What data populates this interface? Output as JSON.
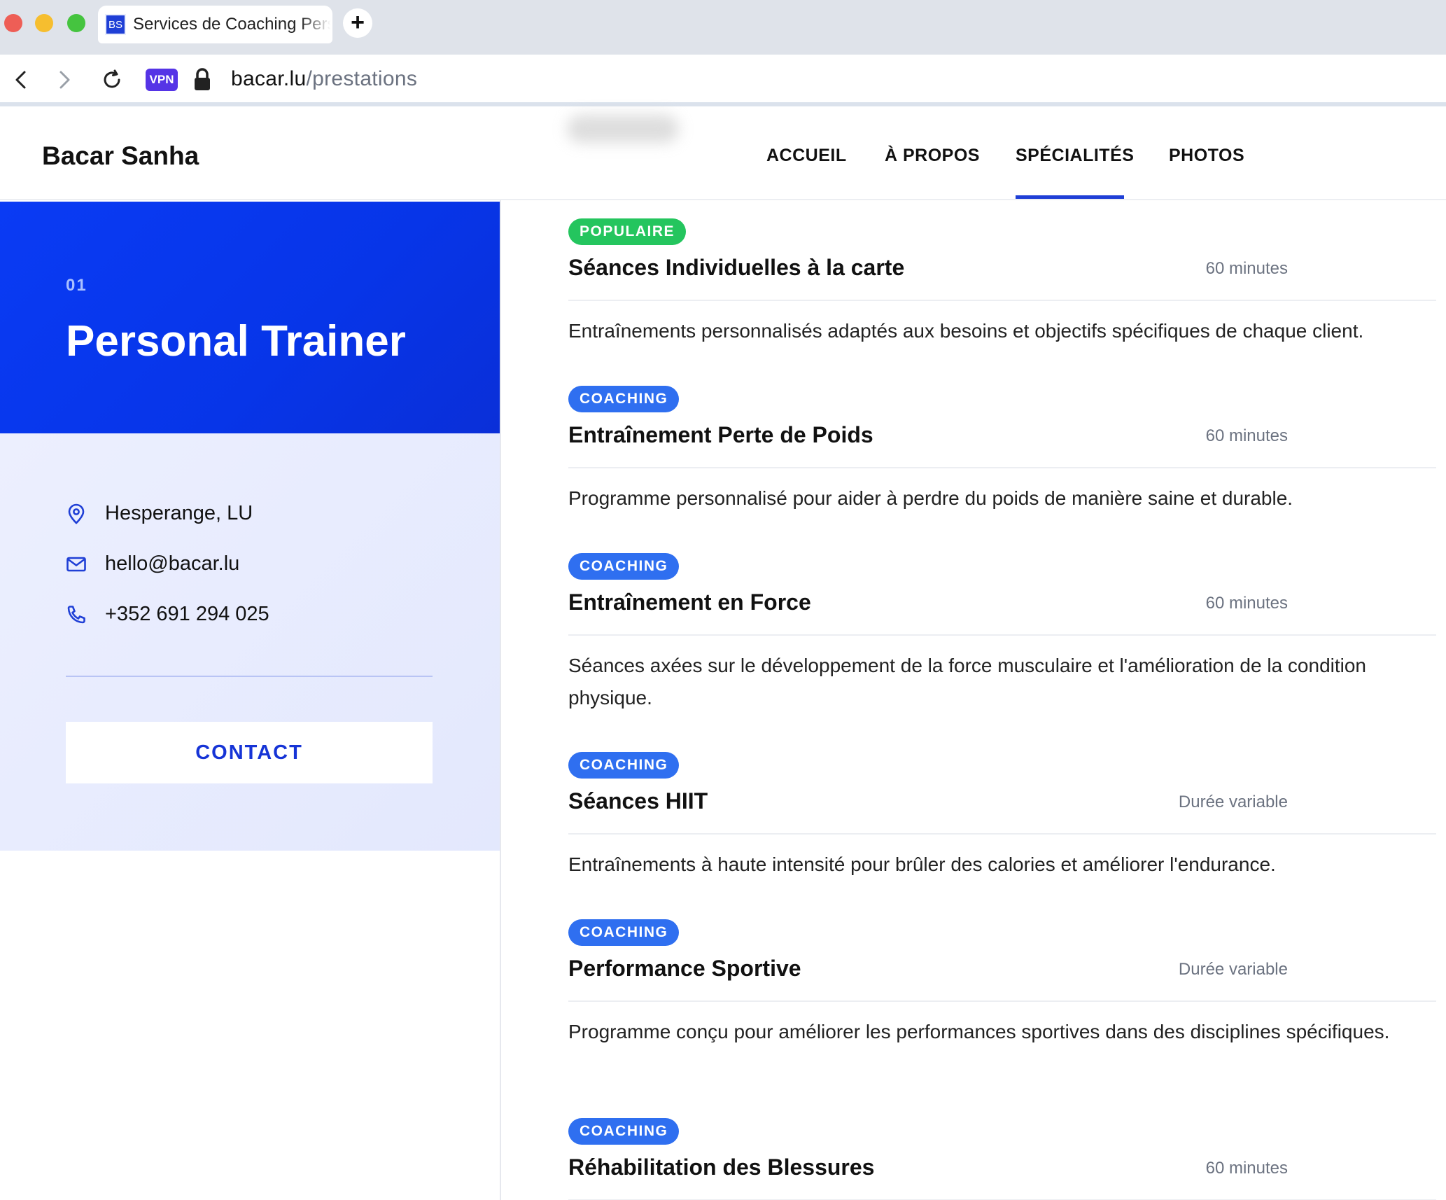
{
  "browser": {
    "tab_favicon": "BS",
    "tab_title": "Services de Coaching Personnalisés",
    "new_tab": "+",
    "vpn": "VPN",
    "url_host": "bacar.lu",
    "url_path": "/prestations"
  },
  "header": {
    "brand": "Bacar Sanha",
    "nav": [
      "ACCUEIL",
      "À PROPOS",
      "SPÉCIALITÉS",
      "PHOTOS"
    ],
    "active_nav": "SPÉCIALITÉS"
  },
  "hero": {
    "number": "01",
    "title": "Personal Trainer"
  },
  "contact": {
    "location": "Hesperange, LU",
    "email": "hello@bacar.lu",
    "phone": "+352 691 294 025",
    "button": "CONTACT"
  },
  "services": [
    {
      "badge": "POPULAIRE",
      "badge_color": "#24c55e",
      "title": "Séances Individuelles à la carte",
      "duration": "60 minutes",
      "description": "Entraînements personnalisés adaptés aux besoins et objectifs spécifiques de chaque client."
    },
    {
      "badge": "COACHING",
      "badge_color": "#2f6ff0",
      "title": "Entraînement Perte de Poids",
      "duration": "60 minutes",
      "description": "Programme personnalisé pour aider à perdre du poids de manière saine et durable."
    },
    {
      "badge": "COACHING",
      "badge_color": "#2f6ff0",
      "title": "Entraînement en Force",
      "duration": "60 minutes",
      "description": "Séances axées sur le développement de la force musculaire et l'amélioration de la condition physique."
    },
    {
      "badge": "COACHING",
      "badge_color": "#2f6ff0",
      "title": "Séances HIIT",
      "duration": "Durée variable",
      "description": "Entraînements à haute intensité pour brûler des calories et améliorer l'endurance."
    },
    {
      "badge": "COACHING",
      "badge_color": "#2f6ff0",
      "title": "Performance Sportive",
      "duration": "Durée variable",
      "description": "Programme conçu pour améliorer les performances sportives dans des disciplines spécifiques."
    },
    {
      "badge": "COACHING",
      "badge_color": "#2f6ff0",
      "title": "Réhabilitation des Blessures",
      "duration": "60 minutes",
      "description": ""
    }
  ],
  "icons": {
    "location": "map-pin-icon",
    "email": "mail-icon",
    "phone": "phone-icon"
  },
  "colors": {
    "accent": "#1f3fd6",
    "hero_bg": "#0a3bf4",
    "popular_badge": "#24c55e",
    "coaching_badge": "#2f6ff0"
  }
}
